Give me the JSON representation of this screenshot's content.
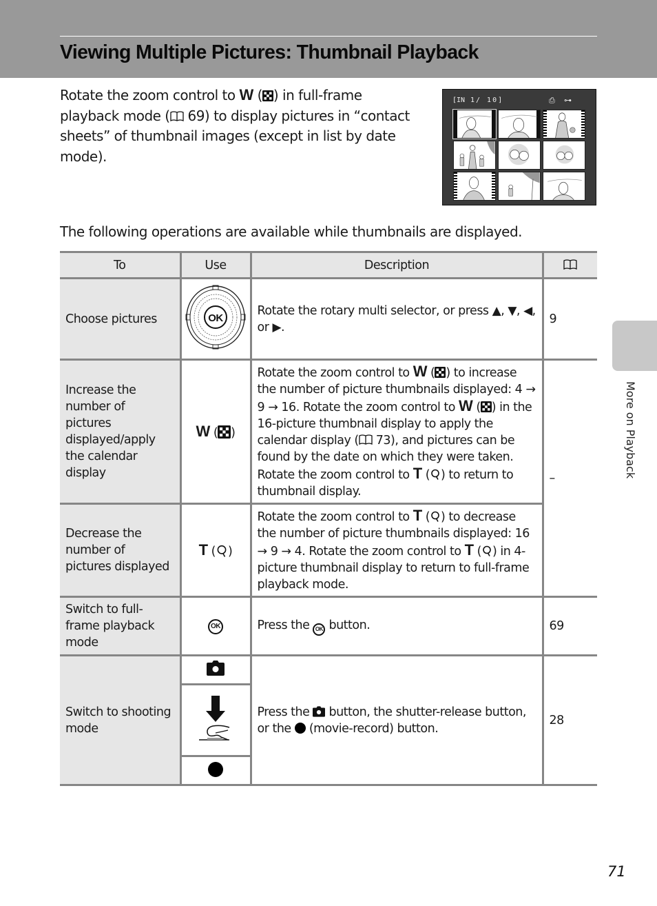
{
  "header": {
    "title": "Viewing Multiple Pictures: Thumbnail Playback"
  },
  "intro": {
    "part1": "Rotate the zoom control to ",
    "w_key": "W",
    "part2": " (",
    "part3": ") in full-frame playback mode (",
    "ref": " 69",
    "part4": ") to display pictures in “contact sheets” of thumbnail images (except in list by date mode)."
  },
  "camera_screen": {
    "memory_indicator": "[IN",
    "frame_counter": "1/  10]",
    "print_icon": "print-order-icon",
    "protect_icon": "protect-key-icon",
    "thumbnail_count": 9
  },
  "lead_text": "The following operations are available while thumbnails are displayed.",
  "table": {
    "headers": {
      "to": "To",
      "use": "Use",
      "description": "Description",
      "page_icon": "book-reference-icon"
    },
    "rows": [
      {
        "to": "Choose pictures",
        "use_icon": "rotary-multi-selector-icon",
        "desc_a": "Rotate the rotary multi selector, or press ",
        "up": "▲",
        "sep1": ", ",
        "down": "▼",
        "sep2": ", ",
        "left": "◀",
        "sep3": ", or ",
        "right": "▶",
        "desc_end": ".",
        "page": "9"
      },
      {
        "to": "Increase the number of pictures displayed/apply the calendar display",
        "use_key": "W",
        "use_icon": "thumbnail-grid-icon",
        "d1": "Rotate the zoom control to ",
        "d1k": "W",
        "d2": ") to increase the number of picture thumbnails displayed: 4 → 9 → 16. Rotate the zoom control to ",
        "d2k": "W",
        "d3": ") in the 16-picture thumbnail display to apply the calendar display (",
        "d3ref": " 73",
        "d4": "), and pictures can be found by the date on which they were taken. Rotate the zoom control to ",
        "d4k": "T",
        "d5": ") to return to thumbnail display.",
        "page": "–"
      },
      {
        "to": "Decrease the number of pictures displayed",
        "use_key": "T",
        "use_icon": "magnify-icon",
        "d1": "Rotate the zoom control to ",
        "d1k": "T",
        "d2": ") to decrease the number of picture thumbnails displayed: 16 → 9 → 4. Rotate the zoom control to ",
        "d2k": "T",
        "d3": ") in 4-picture thumbnail display to return to full-frame playback mode."
      },
      {
        "to": "Switch to full-frame playback mode",
        "use_icon": "ok-button-icon",
        "ok_label": "OK",
        "d1": "Press the ",
        "d2": " button.",
        "page": "69"
      },
      {
        "to": "Switch to shooting mode",
        "use_icons": [
          "camera-icon",
          "shutter-release-press-icon",
          "movie-record-icon"
        ],
        "d1": "Press the ",
        "d2": " button, the shutter-release button, or the ",
        "d3": " (movie-record) button.",
        "page": "28"
      }
    ]
  },
  "side_tab": {
    "label": "More on Playback"
  },
  "page_number": "71"
}
